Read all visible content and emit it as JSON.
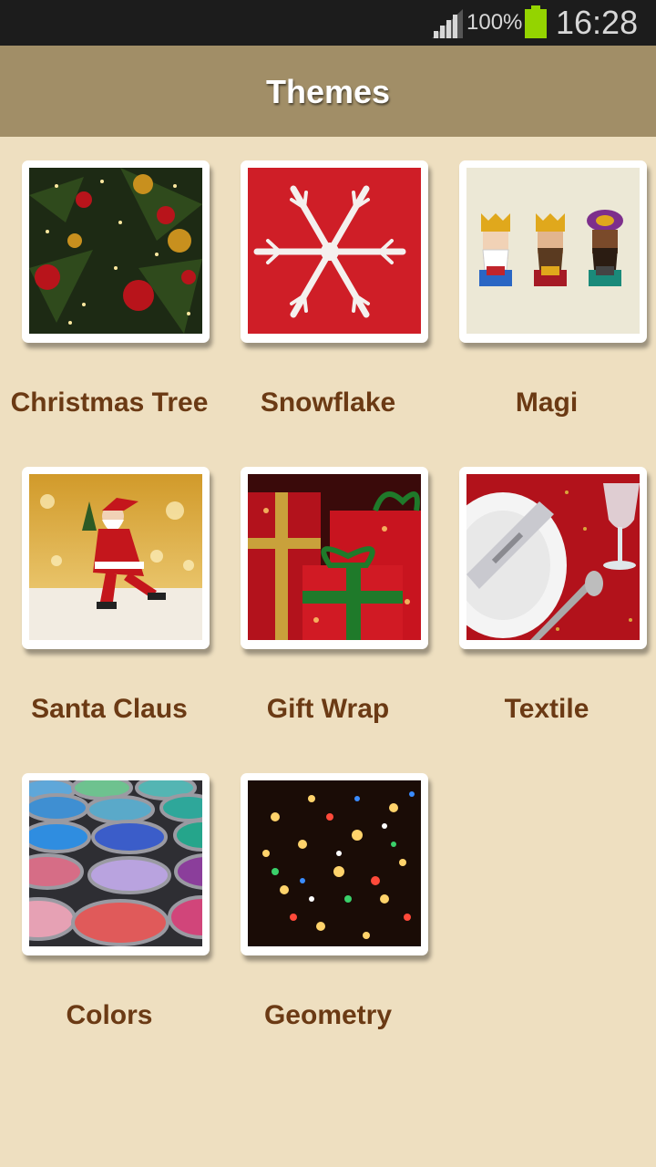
{
  "status_bar": {
    "battery_percent": "100%",
    "time": "16:28"
  },
  "header": {
    "title": "Themes"
  },
  "themes": [
    {
      "label": "Christmas Tree",
      "image": "christmas-tree-photo"
    },
    {
      "label": "Snowflake",
      "image": "snowflake-photo"
    },
    {
      "label": "Magi",
      "image": "three-kings-illustration"
    },
    {
      "label": "Santa Claus",
      "image": "santa-figurine-photo"
    },
    {
      "label": "Gift Wrap",
      "image": "gift-boxes-photo"
    },
    {
      "label": "Textile",
      "image": "table-setting-photo"
    },
    {
      "label": "Colors",
      "image": "paint-pots-photo"
    },
    {
      "label": "Geometry",
      "image": "bokeh-lights-photo"
    }
  ],
  "colors": {
    "action_bar": "#a18e67",
    "background": "#eedfc0",
    "label_text": "#6b3a14",
    "battery": "#94d400"
  }
}
